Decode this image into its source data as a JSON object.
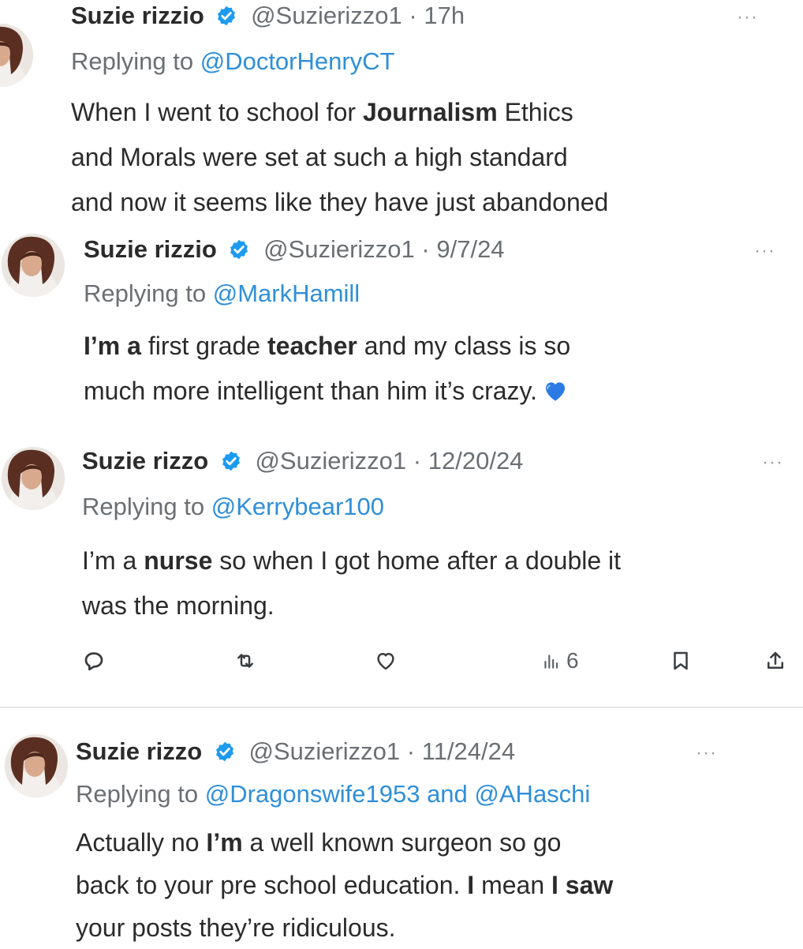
{
  "tweets": [
    {
      "name": "Suzie rizzio",
      "handle": "@Suzierizzo1",
      "sep": "·",
      "date": "17h",
      "reply_prefix": "Replying to ",
      "reply_to": "@DoctorHenryCT",
      "line1_a": "When I went to school for ",
      "line1_b": "Journalism",
      "line1_c": " Ethics",
      "line2": "and Morals were set at such a high standard",
      "line3": "and now it seems like they have just abandoned"
    },
    {
      "name": "Suzie rizzio",
      "handle": "@Suzierizzo1",
      "sep": "·",
      "date": "9/7/24",
      "reply_prefix": "Replying to ",
      "reply_to": "@MarkHamill",
      "line1_a": "I’m a",
      "line1_b": " first grade ",
      "line1_c": "teacher",
      "line1_d": " and my class is so",
      "line2": "much more intelligent than him it’s crazy.",
      "emoji": "blue-heart-emoji"
    },
    {
      "name": "Suzie rizzo",
      "handle": "@Suzierizzo1",
      "sep": "·",
      "date": "12/20/24",
      "reply_prefix": "Replying to ",
      "reply_to": "@Kerrybear100",
      "line1_a": "I’m a ",
      "line1_b": "nurse",
      "line1_c": " so when I got home after a double it",
      "line2": "was the morning.",
      "views": "6"
    },
    {
      "name": "Suzie rizzo",
      "handle": "@Suzierizzo1",
      "sep": "·",
      "date": "11/24/24",
      "reply_prefix": "Replying to ",
      "reply_to": "@Dragonswife1953",
      "reply_and": " and ",
      "reply_to2": "@AHaschi",
      "line1_a": "Actually no ",
      "line1_b": "I’m",
      "line1_c": " a well known surgeon so go",
      "line2_a": "back to your pre school education. ",
      "line2_b": "I",
      "line2_c": " mean ",
      "line2_d": "I saw",
      "line3": "your posts they’re ridiculous."
    }
  ],
  "more_label": "···",
  "colors": {
    "mention": "#2f8fd8",
    "verified": "#1d9bf0",
    "muted": "#6b6f73"
  },
  "icons": [
    "verified-badge-icon",
    "reply-icon",
    "retweet-icon",
    "like-icon",
    "views-icon",
    "bookmark-icon",
    "share-icon"
  ]
}
